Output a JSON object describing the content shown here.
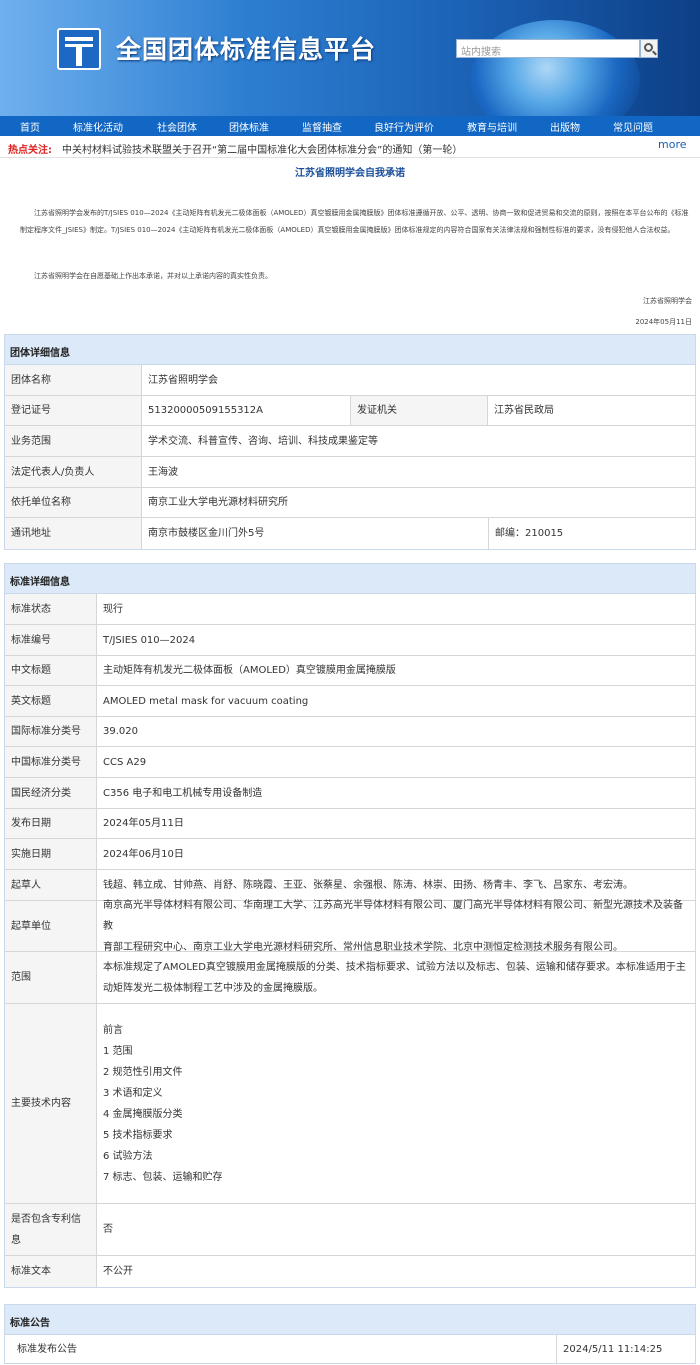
{
  "header": {
    "site_title": "全国团体标准信息平台",
    "search_placeholder": "站内搜索",
    "logo_icon": "platform-logo-icon",
    "search_icon": "search-icon"
  },
  "nav": {
    "items": [
      "首页",
      "标准化活动",
      "社会团体",
      "团体标准",
      "监督抽查",
      "良好行为评价",
      "教育与培训",
      "出版物",
      "常见问题"
    ]
  },
  "hot": {
    "label": "热点关注:",
    "text": "中关村材料试验技术联盟关于召开“第二届中国标准化大会团体标准分会”的通知（第一轮）",
    "more": "more"
  },
  "declaration": {
    "title": "江苏省照明学会自我承诺",
    "para1": "江苏省照明学会发布的T/JSIES 010—2024《主动矩阵有机发光二极体面板（AMOLED）真空镀膜用金属掩膜版》团体标准遵循开放、公平、透明、协商一致和促进贸易和交流的原则，按照在本平台公布的《标准制定程序文件_JSIES》制定。T/JSIES 010—2024《主动矩阵有机发光二极体面板（AMOLED）真空镀膜用金属掩膜版》团体标准规定的内容符合国家有关法律法规和强制性标准的要求，没有侵犯他人合法权益。",
    "para2": "江苏省照明学会在自愿基础上作出本承诺，并对以上承诺内容的真实性负责。",
    "sign_org": "江苏省照明学会",
    "sign_date": "2024年05月11日"
  },
  "org": {
    "header": "团体详细信息",
    "name_label": "团体名称",
    "name": "江苏省照明学会",
    "reg_label": "登记证号",
    "reg": "51320000509155312A",
    "issuer_label": "发证机关",
    "issuer": "江苏省民政局",
    "scope_label": "业务范围",
    "scope": "学术交流、科普宣传、咨询、培训、科技成果鉴定等",
    "rep_label": "法定代表人/负责人",
    "rep": "王海波",
    "host_label": "依托单位名称",
    "host": "南京工业大学电光源材料研究所",
    "addr_label": "通讯地址",
    "addr": "南京市鼓楼区金川门外5号",
    "zip": "邮编：210015"
  },
  "std": {
    "header": "标准详细信息",
    "rows": [
      {
        "label": "标准状态",
        "value": "现行"
      },
      {
        "label": "标准编号",
        "value": "T/JSIES 010—2024"
      },
      {
        "label": "中文标题",
        "value": "主动矩阵有机发光二极体面板（AMOLED）真空镀膜用金属掩膜版"
      },
      {
        "label": "英文标题",
        "value": "AMOLED metal mask for vacuum coating"
      },
      {
        "label": "国际标准分类号",
        "value": "39.020"
      },
      {
        "label": "中国标准分类号",
        "value": "CCS A29"
      },
      {
        "label": "国民经济分类",
        "value": "C356 电子和电工机械专用设备制造"
      },
      {
        "label": "发布日期",
        "value": "2024年05月11日"
      },
      {
        "label": "实施日期",
        "value": "2024年06月10日"
      },
      {
        "label": "起草人",
        "value": "钱超、韩立成、甘帅燕、肖舒、陈晓霞、王亚、张蔡星、余强根、陈涛、林崇、田扬、杨青丰、李飞、吕家东、考宏涛。"
      }
    ],
    "units_label": "起草单位",
    "units_line1": "南京高光半导体材料有限公司、华南理工大学、江苏高光半导体材料有限公司、厦门高光半导体材料有限公司、新型光源技术及装备教",
    "units_line2": "育部工程研究中心、南京工业大学电光源材料研究所、常州信息职业技术学院、北京中测恒定检测技术服务有限公司。",
    "range_label": "范围",
    "range_line1": "本标准规定了AMOLED真空镀膜用金属掩膜版的分类、技术指标要求、试验方法以及标志、包装、运输和储存要求。本标准适用于主",
    "range_line2": "动矩阵发光二极体制程工艺中涉及的金属掩膜版。",
    "content_label": "主要技术内容",
    "contents": [
      "前言",
      "1 范围",
      "2 规范性引用文件",
      "3 术语和定义",
      "4 金属掩膜版分类",
      "5 技术指标要求",
      "6 试验方法",
      "7 标志、包装、运输和贮存"
    ],
    "patent_label_1": "是否包含专利信",
    "patent_label_2": "息",
    "patent": "否",
    "text_label": "标准文本",
    "text": "不公开"
  },
  "notice": {
    "header": "标准公告",
    "link": "标准发布公告",
    "time": "2024/5/11 11:14:25"
  }
}
